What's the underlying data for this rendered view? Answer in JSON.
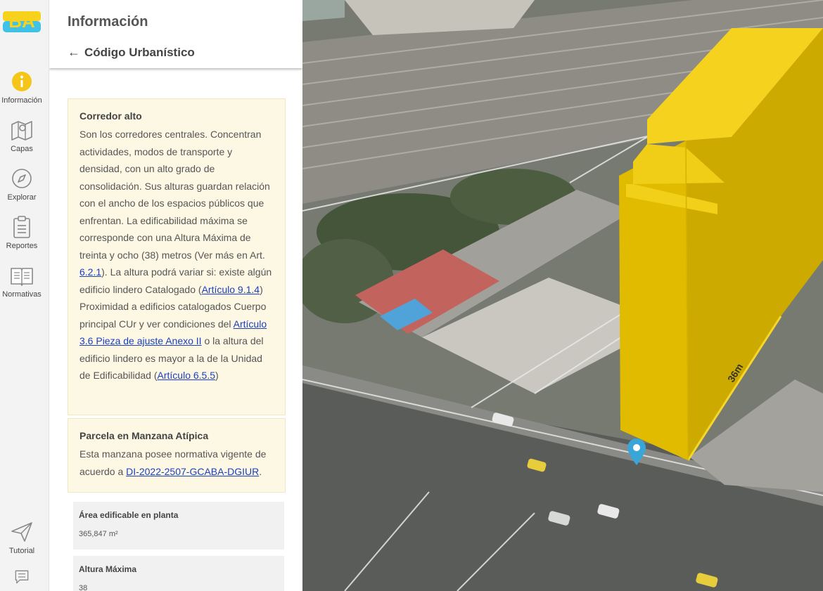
{
  "logo": {
    "text": "BA"
  },
  "nav": [
    {
      "label": "Información",
      "icon": "info-icon"
    },
    {
      "label": "Capas",
      "icon": "map-layers-icon"
    },
    {
      "label": "Explorar",
      "icon": "compass-icon"
    },
    {
      "label": "Reportes",
      "icon": "clipboard-icon"
    },
    {
      "label": "Normativas",
      "icon": "book-icon"
    },
    {
      "label": "Tutorial",
      "icon": "paper-plane-icon"
    },
    {
      "label": "",
      "icon": "feedback-icon"
    }
  ],
  "panel": {
    "title": "Información",
    "back_label": "Código Urbanístico"
  },
  "cards": {
    "corredor": {
      "title": "Corredor alto",
      "t1": "Son los corredores centrales. Concentran actividades, modos de transporte y densidad, con un alto grado de consolidación. Sus alturas guardan relación con el ancho de los espacios públicos que enfrentan. La edificabilidad máxima se corresponde con una Altura Máxima de treinta y ocho (38) metros (Ver más en Art. ",
      "l1": "6.2.1",
      "t2": "). La altura podrá variar si: existe algún edificio lindero Catalogado (",
      "l2": "Artículo 9.1.4",
      "t3": ") Proximidad a edificios catalogados Cuerpo principal CUr y ver condiciones del ",
      "l3": "Artículo 3.6 Pieza de ajuste Anexo II",
      "t4": " o la altura del edificio lindero es mayor a la de la Unidad de Edificabilidad (",
      "l4": "Artículo 6.5.5",
      "t5": ")"
    },
    "parcela": {
      "title": "Parcela en Manzana Atípica",
      "t1": "Esta manzana posee normativa vigente de acuerdo a ",
      "l1": "DI-2022-2507-GCABA-DGIUR",
      "t2": "."
    }
  },
  "stats": [
    {
      "label": "Área edificable en planta",
      "value": "365,847 m²"
    },
    {
      "label": "Altura Máxima",
      "value": "38"
    }
  ],
  "map": {
    "height_label": "36m",
    "building_color": "#f0c800",
    "marker_color": "#3aa6d8"
  }
}
